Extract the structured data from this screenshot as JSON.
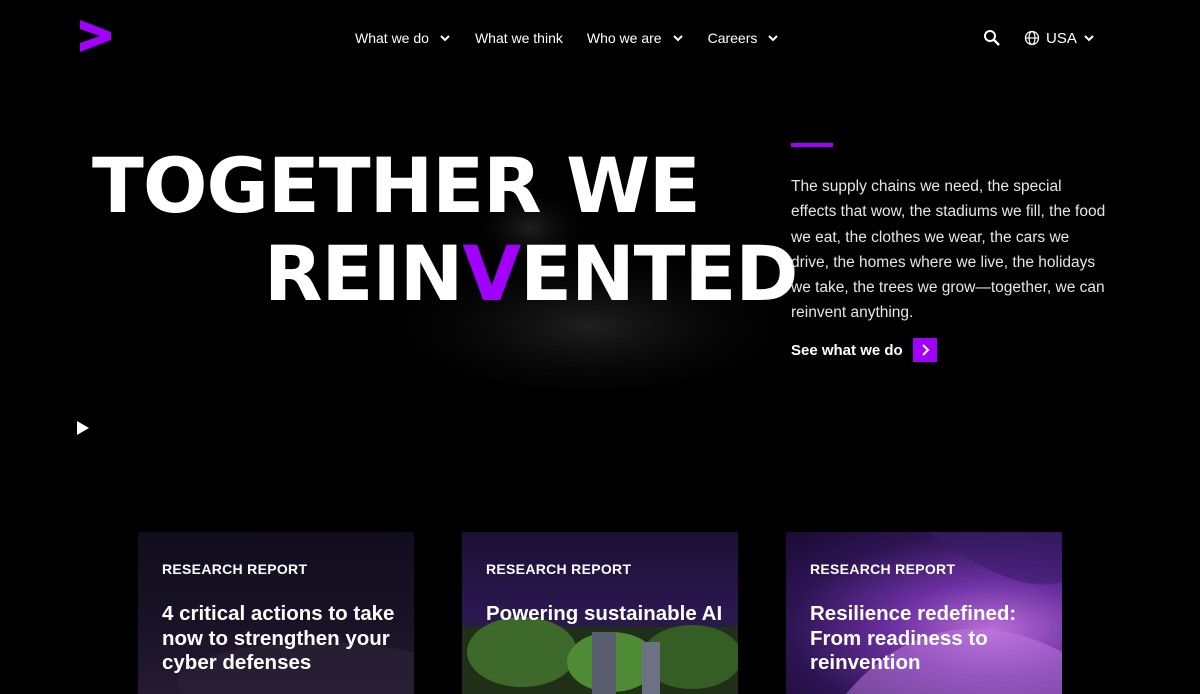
{
  "brand": {
    "logo_icon": "accenture-chevron-logo",
    "accent_color": "#a100ff"
  },
  "nav": {
    "items": [
      {
        "label": "What we do",
        "has_dropdown": true
      },
      {
        "label": "What we think",
        "has_dropdown": false
      },
      {
        "label": "Who we are",
        "has_dropdown": true
      },
      {
        "label": "Careers",
        "has_dropdown": true
      }
    ],
    "search_icon": "search-icon",
    "locale": {
      "label": "USA",
      "icon": "globe-icon"
    }
  },
  "hero": {
    "headline_line1": "TOGETHER WE",
    "headline_line2_before": "REIN",
    "headline_line2_accent": "V",
    "headline_line2_after": "ENTED",
    "lede": "The supply chains we need, the special effects that wow, the stadiums we fill, the food we eat, the clothes we wear, the cars we drive, the homes where we live, the holidays we take, the trees we grow—together, we can reinvent anything.",
    "cta_label": "See what we do",
    "play_icon": "play-icon"
  },
  "cards": [
    {
      "kicker": "RESEARCH REPORT",
      "title": "4 critical actions to take now to strengthen your cyber defenses"
    },
    {
      "kicker": "RESEARCH REPORT",
      "title": "Powering sustainable AI"
    },
    {
      "kicker": "RESEARCH REPORT",
      "title": "Resilience redefined: From readiness to reinvention"
    }
  ]
}
